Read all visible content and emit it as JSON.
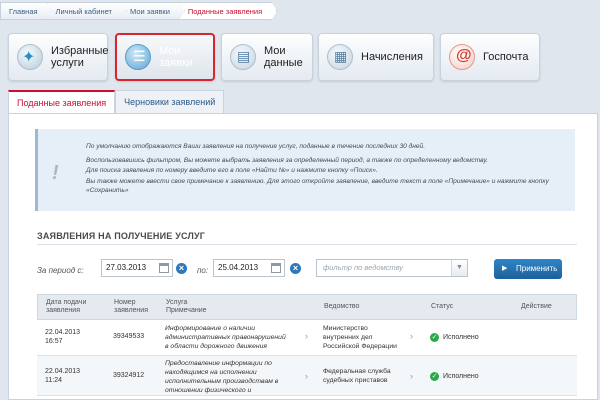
{
  "breadcrumb": [
    "Главная",
    "Личный кабинет",
    "Мои заявки",
    "Поданные заявления"
  ],
  "nav": {
    "favorites": "Избранные\nуслуги",
    "my_requests": "Мои\nзаявки",
    "my_data": "Мои\nданные",
    "charges": "Начисления",
    "gospochta": "Госпочта"
  },
  "subtabs": [
    "Поданные заявления",
    "Черновики заявлений"
  ],
  "info": {
    "p1": "По умолчанию отображаются Ваши заявления на получение услуг, поданные в течение последних 30 дней.",
    "p2": "Воспользовавшись фильтром, Вы можете выбрать заявления за определенный период, а также по определенному ведомству.",
    "p3": "Для поиска заявления по номеру введите его в поле «Найти №» и нажмите кнопку «Поиск».",
    "p4": "Вы также можете ввести свое примечание к заявлению. Для этого откройте заявление, введите текст в поле «Примечание» и нажмите кнопку «Сохранить»"
  },
  "section_title": "ЗАЯВЛЕНИЯ НА ПОЛУЧЕНИЕ УСЛУГ",
  "filters": {
    "from_label": "За период с:",
    "from_value": "27.03.2013",
    "to_label": "по:",
    "to_value": "25.04.2013",
    "dept_placeholder": "фильтр по ведомству",
    "apply_label": "Применить"
  },
  "table": {
    "headers": {
      "date": "Дата подачи\nзаявления",
      "number": "Номер\nзаявления",
      "service": "Услуга\nПримечание",
      "dept": "Ведомство",
      "status": "Статус",
      "action": "Действие"
    },
    "rows": [
      {
        "date": "22.04.2013\n16:57",
        "number": "39349533",
        "service": "Информирование о наличии\nадминистративных правонарушений\nв области дорожного движения",
        "dept": "Министерство\nвнутренних дел\nРоссийской Федерации",
        "status": "Исполнено"
      },
      {
        "date": "22.04.2013\n11:24",
        "number": "39324912",
        "service": "Предоставление информации по\nнаходящимся на исполнении\nисполнительным производствам в\nотношении физического и",
        "dept": "Федеральная служба\nсудебных приставов",
        "status": "Исполнено"
      }
    ]
  }
}
